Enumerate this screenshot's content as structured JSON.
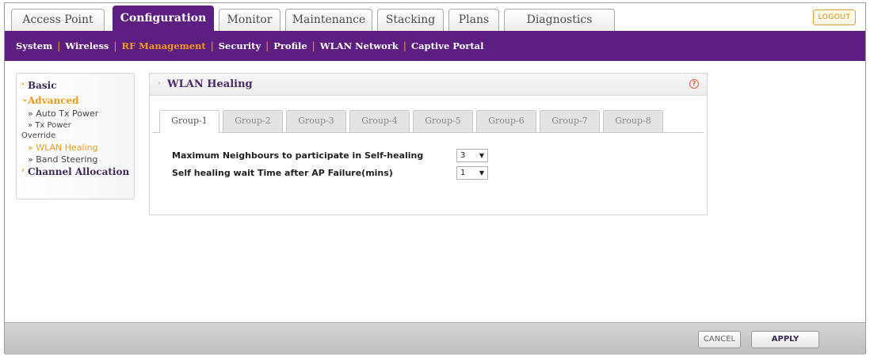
{
  "top_tabs": [
    {
      "label": "Access Point"
    },
    {
      "label": "Configuration"
    },
    {
      "label": "Monitor"
    },
    {
      "label": "Maintenance"
    },
    {
      "label": "Stacking"
    },
    {
      "label": "Plans"
    },
    {
      "label": "Diagnostics"
    }
  ],
  "logout_label": "LOGOUT",
  "subnav": [
    {
      "label": "System"
    },
    {
      "label": "Wireless"
    },
    {
      "label": "RF Management"
    },
    {
      "label": "Security"
    },
    {
      "label": "Profile"
    },
    {
      "label": "WLAN Network"
    },
    {
      "label": "Captive Portal"
    }
  ],
  "sidebar": {
    "basic": "Basic",
    "advanced": "Advanced",
    "items": [
      {
        "label": "» Auto Tx Power"
      },
      {
        "label": "» Tx Power"
      },
      {
        "label": "Override"
      },
      {
        "label": "» WLAN Healing"
      },
      {
        "label": "» Band Steering"
      }
    ],
    "channel_allocation": "Channel Allocation"
  },
  "panel": {
    "title": "WLAN Healing",
    "help": "?",
    "group_tabs": [
      "Group-1",
      "Group-2",
      "Group-3",
      "Group-4",
      "Group-5",
      "Group-6",
      "Group-7",
      "Group-8"
    ],
    "max_neighbours_label": "Maximum Neighbours to participate in Self-healing",
    "max_neighbours_value": "3",
    "wait_time_label": "Self healing wait Time after AP Failure(mins)",
    "wait_time_value": "1"
  },
  "footer": {
    "cancel": "CANCEL",
    "apply": "APPLY"
  },
  "colors": {
    "brand_purple": "#5c1e80",
    "accent_orange": "#f39a1c"
  }
}
